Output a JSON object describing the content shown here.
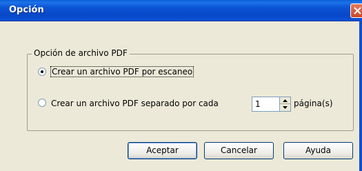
{
  "window": {
    "title": "Opción",
    "close_icon": "close-icon"
  },
  "group": {
    "legend": "Opción de archivo PDF"
  },
  "options": [
    {
      "label": "Crear un archivo PDF por escaneo",
      "selected": true
    },
    {
      "label": "Crear un archivo PDF separado por cada",
      "selected": false
    }
  ],
  "pages": {
    "value": "1",
    "unit_label": "página(s)"
  },
  "buttons": {
    "ok": "Aceptar",
    "cancel": "Cancelar",
    "help": "Ayuda"
  }
}
